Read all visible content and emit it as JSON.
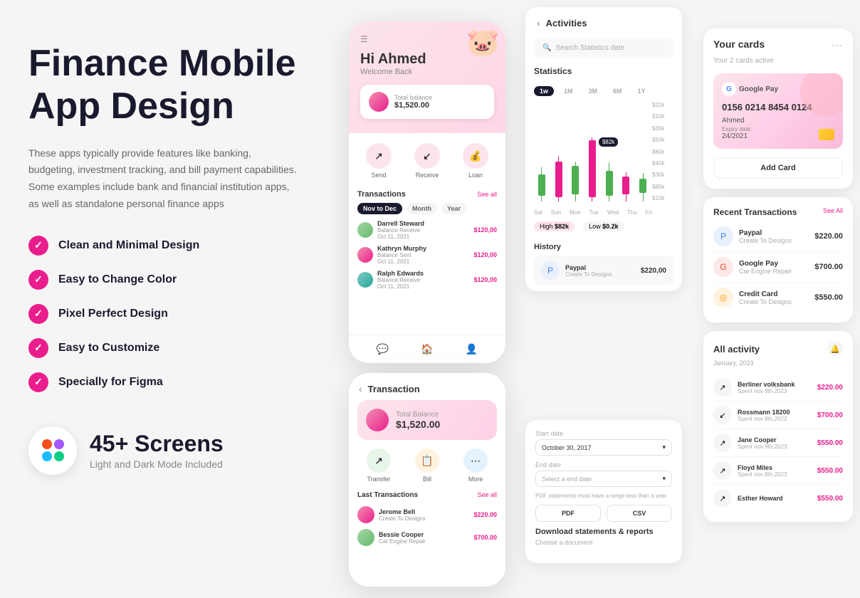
{
  "left": {
    "title_line1": "Finance Mobile",
    "title_line2": "App Design",
    "description": "These apps typically provide features like banking, budgeting, investment tracking, and bill payment capabilities. Some examples include bank and financial institution apps, as well as standalone personal finance apps",
    "features": [
      "Clean and Minimal Design",
      "Easy to Change Color",
      "Pixel Perfect Design",
      "Easy to Customize",
      "Specially for Figma"
    ],
    "screens_count": "45+ Screens",
    "screens_sub": "Light and Dark Mode Included"
  },
  "phone1": {
    "greeting": "Hi Ahmed",
    "welcome": "Welcome Back",
    "balance_label": "Total balance",
    "balance_amount": "$1,520.00",
    "actions": [
      "Send",
      "Receive",
      "Loan"
    ],
    "section_title": "Transactions",
    "see_all": "See all",
    "tabs": [
      "Nov to Dec",
      "Month",
      "Year"
    ],
    "transactions": [
      {
        "name": "Darrell Steward",
        "sub": "Balance Receive",
        "amount": "$120,00",
        "date": "Oct 11, 2021",
        "type": "income"
      },
      {
        "name": "Kathryn Murphy",
        "sub": "Balance Sent",
        "amount": "$120,00",
        "date": "Oct 11, 2021",
        "type": "expense"
      },
      {
        "name": "Ralph Edwards",
        "sub": "Balance Receive",
        "amount": "$120,00",
        "date": "Oct 11, 2021",
        "type": "income"
      }
    ]
  },
  "phone2": {
    "title": "Transaction",
    "balance_label": "Total Balance",
    "balance_amount": "$1,520.00",
    "actions": [
      "Transfer",
      "Bill",
      "More"
    ],
    "last_txn_title": "Last Transactions",
    "see_all": "See all",
    "transactions": [
      {
        "name": "Jerome Bell",
        "sub": "Create To Designs",
        "amount": "$220.00"
      },
      {
        "name": "Bessie Cooper",
        "sub": "Car Engine Repair",
        "amount": "$700.00"
      }
    ]
  },
  "activities": {
    "title": "Activities",
    "search_placeholder": "Search Statistics date",
    "stats_title": "Statistics",
    "time_options": [
      "1w",
      "1M",
      "3M",
      "6M",
      "1Y"
    ],
    "y_labels": [
      "$22k",
      "$10k",
      "$30k",
      "$50k",
      "$60k",
      "$40k",
      "$30k",
      "$80k",
      "$10k"
    ],
    "x_labels": [
      "Sat",
      "Sun",
      "Mon",
      "Tue",
      "Wed",
      "Thu",
      "Fri"
    ],
    "high_label": "High",
    "high_value": "$82k",
    "low_label": "Low",
    "low_value": "$0.2k",
    "history_title": "History",
    "history_item": {
      "name": "Paypal",
      "sub": "Create To Designs",
      "amount": "$220,00"
    }
  },
  "download": {
    "title": "Download",
    "subtitle": "statements & reports",
    "description": "Choose a document",
    "start_label": "Start date",
    "start_value": "October 30, 2017",
    "end_label": "End date",
    "end_placeholder": "Select a end date",
    "notice": "PDF statements must have a range less than a year",
    "pdf_label": "PDF",
    "csv_label": "CSV"
  },
  "right": {
    "cards_title": "Your cards",
    "cards_sub": "Your 2 cards active",
    "card": {
      "provider": "Google Pay",
      "number": "0156 0214 8454 0124",
      "name": "Ahmed",
      "expiry_label": "Expiry date:",
      "expiry": "24/2021"
    },
    "add_card": "Add Card",
    "recent_txn_title": "Recent Transactions",
    "see_all": "See All",
    "recent_transactions": [
      {
        "name": "Paypal",
        "sub": "Create To Designs",
        "amount": "$220.00",
        "icon_type": "paypal"
      },
      {
        "name": "Google Pay",
        "sub": "Car Engine Repair",
        "amount": "$700.00",
        "icon_type": "google"
      },
      {
        "name": "Credit Card",
        "sub": "Create To Designs",
        "amount": "$550.00",
        "icon_type": "mastercard"
      }
    ],
    "all_activity_title": "All activity",
    "all_activity_date": "January, 2023",
    "activities": [
      {
        "name": "Berliner volksbank",
        "sub": "Spent nov 8th,2023",
        "amount": "$220.00"
      },
      {
        "name": "Rossmann 18200",
        "sub": "Spent nov 8th,2022",
        "amount": "$700.00"
      },
      {
        "name": "Jane Cooper",
        "sub": "Spent nov 8th,2023",
        "amount": "$550.00"
      },
      {
        "name": "Floyd Miles",
        "sub": "Spent nov 8th,2023",
        "amount": "$550.00"
      },
      {
        "name": "Esther Howard",
        "sub": "",
        "amount": "$550.00"
      }
    ]
  }
}
